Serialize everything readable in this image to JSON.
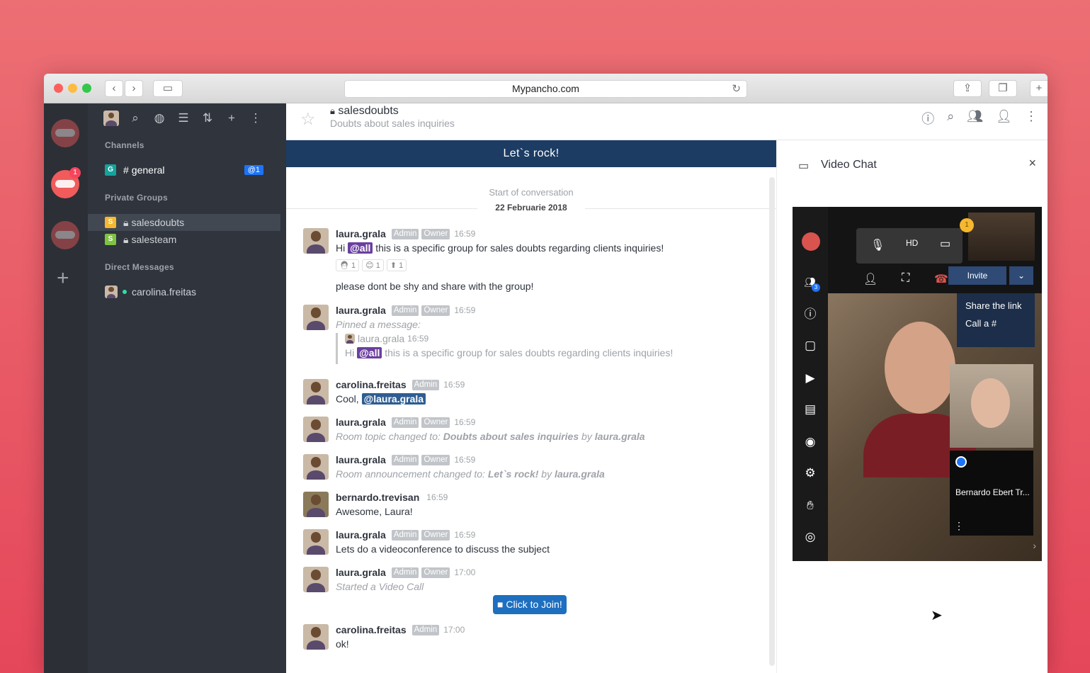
{
  "browser": {
    "url": "Mypancho.com"
  },
  "rail": {
    "badge": "1"
  },
  "sidebar": {
    "sections": {
      "channels": "Channels",
      "private_groups": "Private Groups",
      "direct_messages": "Direct Messages"
    },
    "channels": [
      {
        "initial": "G",
        "label": "general",
        "mention": "@1",
        "color": "#15a39b"
      }
    ],
    "groups": [
      {
        "initial": "S",
        "label": "salesdoubts",
        "color": "#f5b82e"
      },
      {
        "initial": "S",
        "label": "salesteam",
        "color": "#80c342"
      }
    ],
    "dms": [
      {
        "label": "carolina.freitas"
      }
    ]
  },
  "room": {
    "name": "salesdoubts",
    "topic": "Doubts about sales inquiries",
    "announcement": "Let`s rock!"
  },
  "chat": {
    "start": "Start of conversation",
    "date": "22 Februarie 2018",
    "messages": [
      {
        "user": "laura.grala",
        "roles": [
          "Admin",
          "Owner"
        ],
        "time": "16:59",
        "mention": "@all",
        "text": "this is a specific group for sales doubts regarding clients inquiries!",
        "hi": "Hi",
        "reactions": [
          "1",
          "1",
          "1"
        ],
        "text2": "please dont be shy and share with the group!"
      },
      {
        "user": "laura.grala",
        "roles": [
          "Admin",
          "Owner"
        ],
        "time": "16:59",
        "system": "Pinned a message:",
        "quote_user": "laura.grala",
        "quote_time": "16:59",
        "quote_hi": "Hi",
        "quote_mention": "@all",
        "quote_text": "this is a specific group for sales doubts regarding clients inquiries!"
      },
      {
        "user": "carolina.freitas",
        "roles": [
          "Admin"
        ],
        "time": "16:59",
        "text": "Cool,",
        "mention": "@laura.grala"
      },
      {
        "user": "laura.grala",
        "roles": [
          "Admin",
          "Owner"
        ],
        "time": "16:59",
        "system": "Room topic changed to:",
        "bold": "Doubts about sales inquiries",
        "by": "by",
        "byuser": "laura.grala"
      },
      {
        "user": "laura.grala",
        "roles": [
          "Admin",
          "Owner"
        ],
        "time": "16:59",
        "system": "Room announcement changed to:",
        "bold": "Let`s rock!",
        "by": "by",
        "byuser": "laura.grala"
      },
      {
        "user": "bernardo.trevisan",
        "roles": [],
        "time": "16:59",
        "text": "Awesome, Laura!"
      },
      {
        "user": "laura.grala",
        "roles": [
          "Admin",
          "Owner"
        ],
        "time": "16:59",
        "text": "Lets do a videoconference to discuss the subject"
      },
      {
        "user": "laura.grala",
        "roles": [
          "Admin",
          "Owner"
        ],
        "time": "17:00",
        "system": "Started a Video Call"
      },
      {
        "user": "carolina.freitas",
        "roles": [
          "Admin"
        ],
        "time": "17:00",
        "text": "ok!"
      }
    ],
    "join_label": "Click to Join!"
  },
  "video": {
    "title": "Video Chat",
    "close": "×",
    "participants_count": "3",
    "badge": "1",
    "hd": "HD",
    "invite": "Invite",
    "menu": [
      "Share the link",
      "Call a #"
    ],
    "participant_name": "Bernardo Ebert Tr..."
  }
}
